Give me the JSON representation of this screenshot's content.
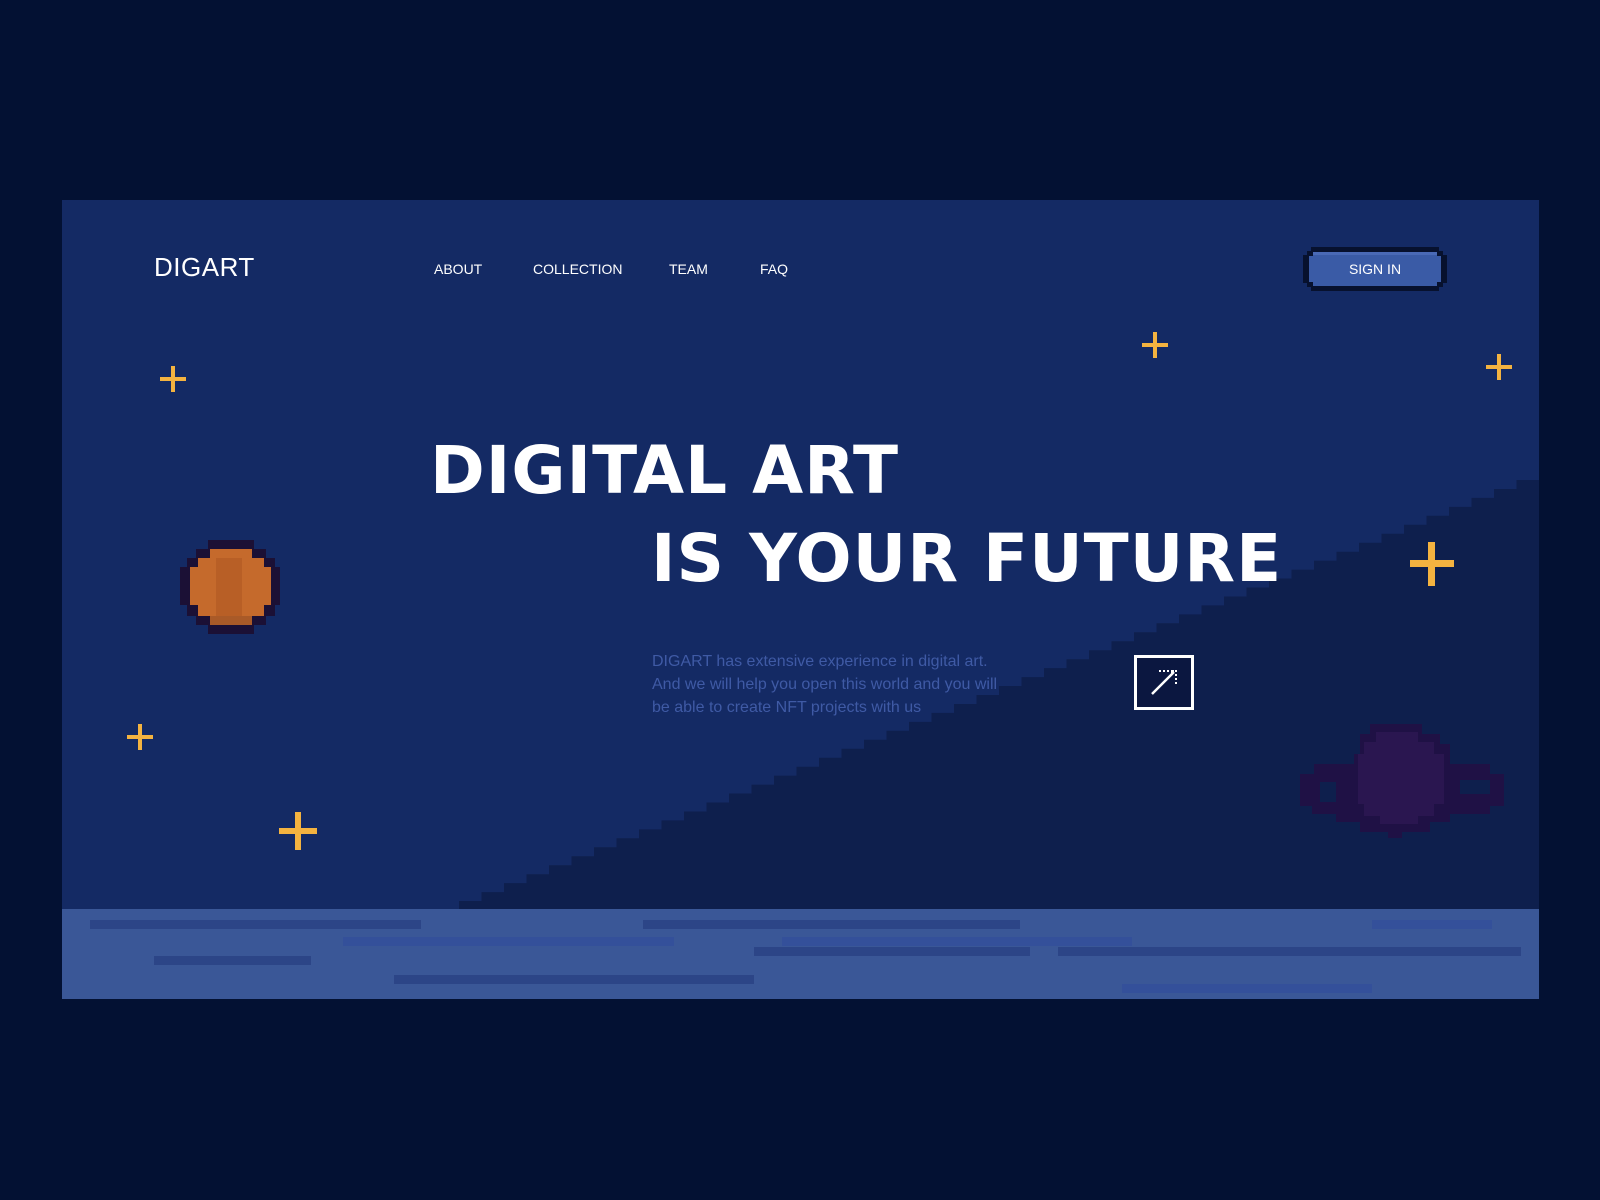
{
  "brand": {
    "logo": "DIGART"
  },
  "nav": {
    "items": [
      {
        "label": "ABOUT"
      },
      {
        "label": "COLLECTION"
      },
      {
        "label": "TEAM"
      },
      {
        "label": "FAQ"
      }
    ],
    "signin_label": "SIGN IN"
  },
  "hero": {
    "line1": "DIGITAL ART",
    "line2": "IS YOUR FUTURE",
    "description": "DIGART has extensive experience in digital art. And we will help you open this world and you will be able to create NFT projects with us",
    "cta_icon": "arrow-up-right-icon"
  },
  "decor": {
    "icons": [
      "sparkle-icon",
      "orange-planet-icon",
      "ringed-planet-icon"
    ]
  },
  "colors": {
    "page_bg": "#031133",
    "sky": "#142a64",
    "hill": "#0e1f4d",
    "ground": "#3a5797",
    "ground_line": "#2c4587",
    "star": "#f4b340",
    "button_bg": "#3a5ba6",
    "button_border": "#07112e",
    "planet_orange": "#c56a2c",
    "planet_outline": "#1b1035",
    "planet_purple": "#2a1650",
    "text": "#ffffff",
    "muted_text": "#3f5aa5"
  }
}
